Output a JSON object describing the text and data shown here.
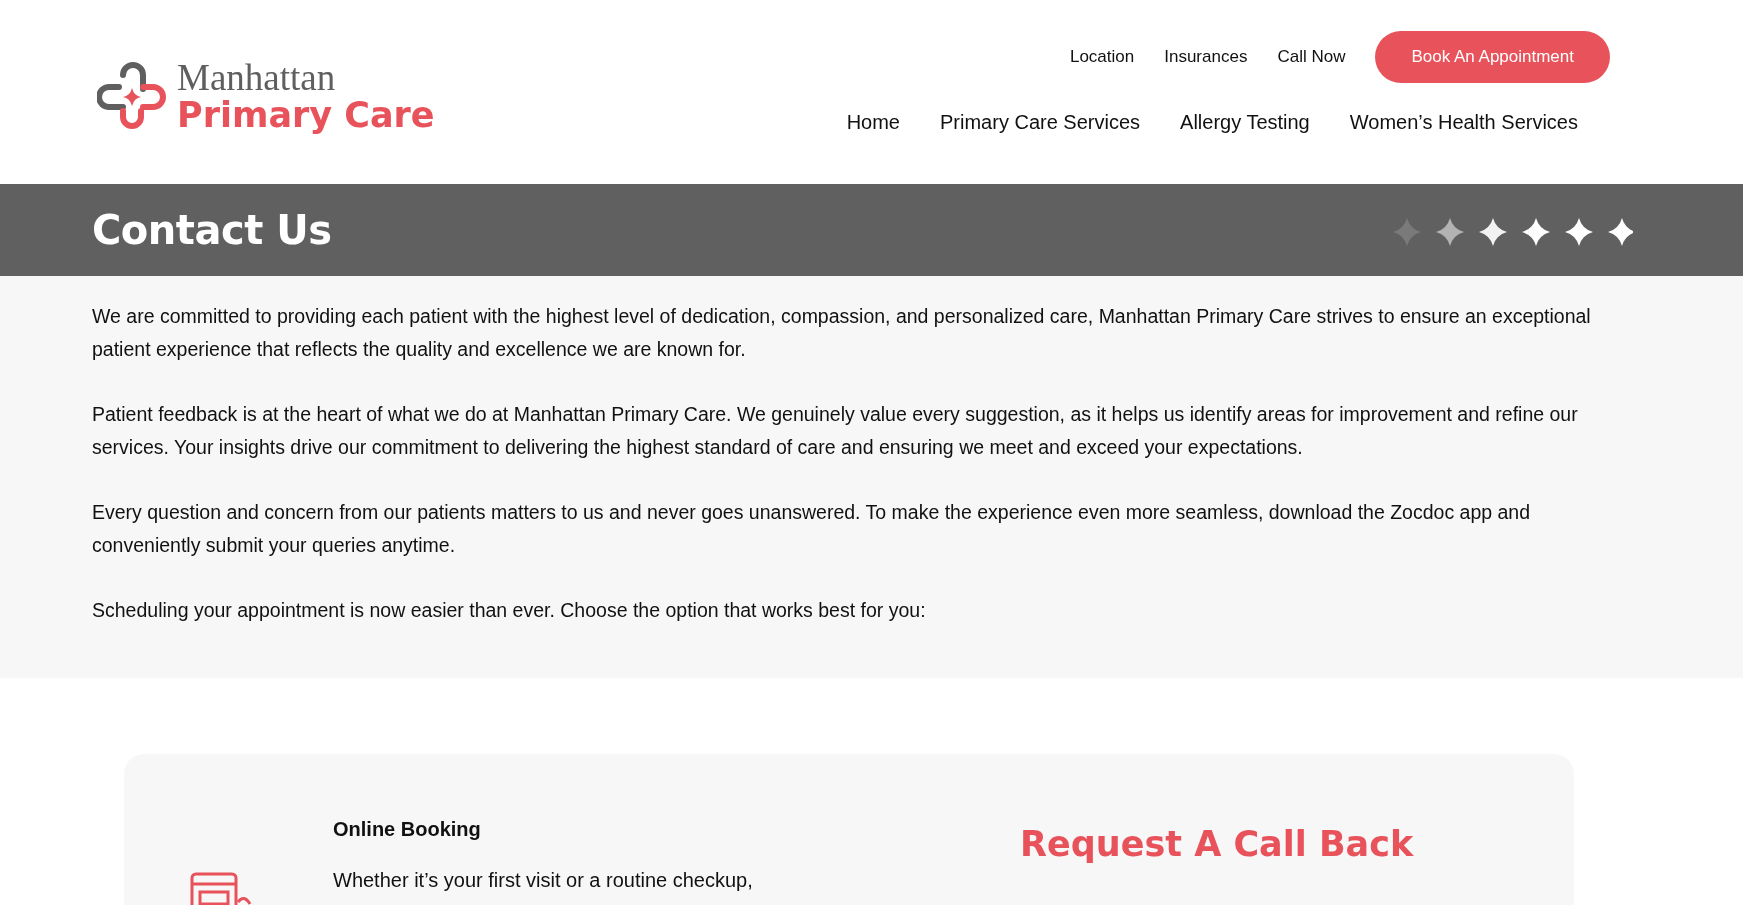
{
  "logo": {
    "line1": "Manhattan",
    "line2": "Primary Care"
  },
  "top_links": [
    "Location",
    "Insurances",
    "Call Now"
  ],
  "cta": "Book An Appointment",
  "main_nav": [
    "Home",
    "Primary Care Services",
    "Allergy Testing",
    "Women’s Health Services"
  ],
  "banner": {
    "title": "Contact Us"
  },
  "paragraphs": [
    "We are committed to providing each patient with the highest level of dedication, compassion, and personalized care, Manhattan Primary Care strives to ensure an exceptional patient experience that reflects the quality and excellence we are known for.",
    "Patient feedback is at the heart of what we do at Manhattan Primary Care. We genuinely value every suggestion, as it helps us identify areas for improvement and refine our services. Your insights drive our commitment to delivering the highest standard of care and ensuring we meet and exceed your expectations.",
    "Every question and concern from our patients matters to us and never goes unanswered. To make the experience even more seamless, download the Zocdoc app and conveniently submit your queries anytime.",
    "Scheduling your appointment is now easier than ever. Choose the option that works best for you:"
  ],
  "card": {
    "option": {
      "title": "Online Booking",
      "text": "Whether it’s your first visit or a routine checkup,"
    },
    "form_title": "Request A Call Back"
  }
}
